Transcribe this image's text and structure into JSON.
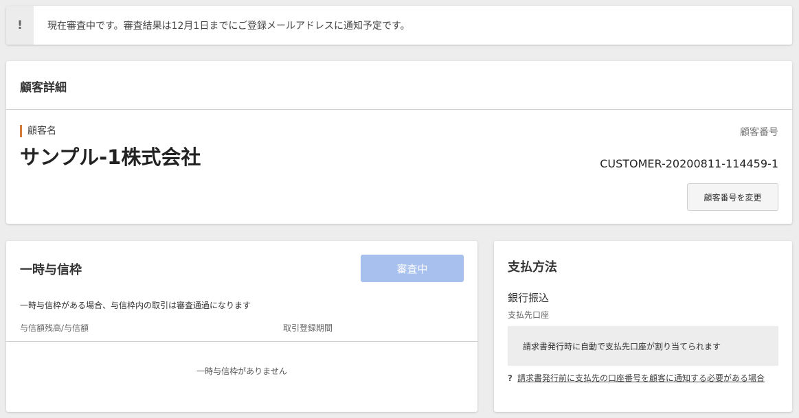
{
  "notice": {
    "icon": "exclamation-icon",
    "icon_glyph": "!",
    "message": "現在審査中です。審査結果は12月1日までにご登録メールアドレスに通知予定です。"
  },
  "customer": {
    "title": "顧客詳細",
    "name_label": "顧客名",
    "name": "サンプル-1株式会社",
    "number_label": "顧客番号",
    "number": "CUSTOMER-20200811-114459-1",
    "change_button": "顧客番号を変更"
  },
  "credit": {
    "title": "一時与信枠",
    "status_button": "審査中",
    "description": "一時与信枠がある場合、与信枠内の取引は審査通過になります",
    "columns": [
      "与信額残高/与信額",
      "取引登録期間"
    ],
    "empty_message": "一時与信枠がありません"
  },
  "payment": {
    "title": "支払方法",
    "method": "銀行振込",
    "account_label": "支払先口座",
    "info": "請求書発行時に自動で支払先口座が割り当てられます",
    "help_icon": "question-icon",
    "help_glyph": "?",
    "help_link": "請求書発行前に支払先の口座番号を顧客に通知する必要がある場合"
  },
  "colors": {
    "accent_bar": "#d27d3c",
    "status_button_bg": "#a8c0ee",
    "background": "#ededed"
  }
}
